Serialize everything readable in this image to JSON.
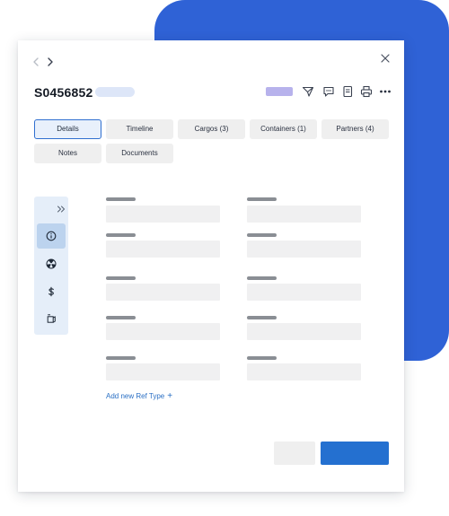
{
  "record": {
    "id": "S0456852"
  },
  "tabs": [
    {
      "label": "Details",
      "active": true
    },
    {
      "label": "Timeline"
    },
    {
      "label": "Cargos (3)"
    },
    {
      "label": "Containers (1)"
    },
    {
      "label": "Partners (4)"
    },
    {
      "label": "Notes"
    },
    {
      "label": "Documents"
    }
  ],
  "header_icons": [
    "send-icon",
    "comment-icon",
    "notebook-icon",
    "print-icon",
    "more-icon"
  ],
  "side_rail": [
    "expand-icon",
    "info-icon",
    "hazard-icon",
    "dollar-icon",
    "box-icon"
  ],
  "form": {
    "add_ref_label": "Add new Ref Type",
    "add_ref_symbol": "+"
  },
  "colors": {
    "accent": "#2470d0",
    "background_card": "#2f62d6",
    "status_chip": "#b7b2ec",
    "active_tab_border": "#2f6fd0"
  }
}
